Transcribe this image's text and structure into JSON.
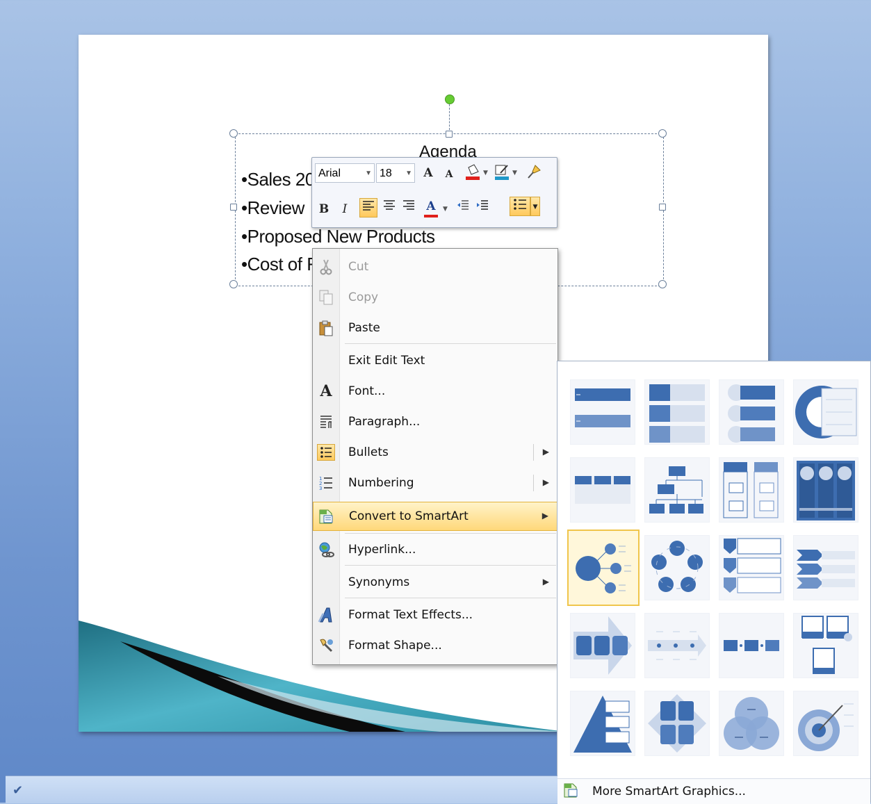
{
  "slide": {
    "title": "Agenda",
    "bullets": [
      "•Sales 20",
      "•Review",
      "•Proposed New Products",
      "•Cost of F"
    ]
  },
  "mini_toolbar": {
    "font": "Arial",
    "size": "18",
    "bold": "B",
    "italic": "I",
    "font_color_letter": "A",
    "grow_font": "A",
    "shrink_font": "A"
  },
  "context_menu": {
    "items": [
      {
        "label": "Cut",
        "enabled": false,
        "icon": "scissors-icon"
      },
      {
        "label": "Copy",
        "enabled": false,
        "icon": "copy-icon"
      },
      {
        "label": "Paste",
        "enabled": true,
        "icon": "paste-icon"
      },
      {
        "label": "Exit Edit Text",
        "enabled": true
      },
      {
        "label": "Font...",
        "enabled": true,
        "icon": "font-icon"
      },
      {
        "label": "Paragraph...",
        "enabled": true,
        "icon": "paragraph-icon"
      },
      {
        "label": "Bullets",
        "enabled": true,
        "icon": "bullets-icon",
        "submenu": true
      },
      {
        "label": "Numbering",
        "enabled": true,
        "icon": "numbering-icon",
        "submenu": true
      },
      {
        "label": "Convert to SmartArt",
        "enabled": true,
        "icon": "smartart-icon",
        "submenu": true,
        "highlighted": true
      },
      {
        "label": "Hyperlink...",
        "enabled": true,
        "icon": "hyperlink-icon"
      },
      {
        "label": "Synonyms",
        "enabled": true,
        "submenu": true
      },
      {
        "label": "Format Text Effects...",
        "enabled": true,
        "icon": "text-effects-icon"
      },
      {
        "label": "Format Shape...",
        "enabled": true,
        "icon": "format-shape-icon"
      }
    ],
    "font_icon_glyph": "A"
  },
  "smartart_gallery": {
    "more_label": "More SmartArt Graphics...",
    "layouts": [
      "basic-block-list",
      "vertical-bullet-list",
      "vertical-box-list",
      "stacked-list",
      "horizontal-bullet-list",
      "table-hierarchy",
      "lined-list",
      "vertical-picture-list",
      "radial-cluster",
      "basic-cycle",
      "vertical-chevron-list",
      "chevron-list",
      "process-arrows",
      "process-line",
      "basic-process",
      "picture-caption",
      "pyramid-list",
      "matrix",
      "venn",
      "target"
    ],
    "selected_index": 8
  },
  "colors": {
    "accent_blue": "#4a72b0",
    "highlight": "#ffd87a",
    "rotation_handle": "#66cc33"
  }
}
